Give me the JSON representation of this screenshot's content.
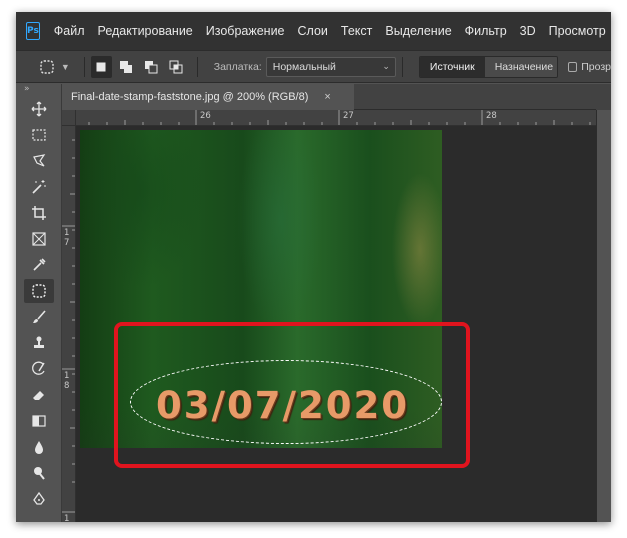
{
  "menubar": {
    "logo": "Ps",
    "items": [
      "Файл",
      "Редактирование",
      "Изображение",
      "Слои",
      "Текст",
      "Выделение",
      "Фильтр",
      "3D",
      "Просмотр"
    ]
  },
  "options": {
    "patch_label": "Заплатка:",
    "patch_mode": "Нормальный",
    "source_label": "Источник",
    "destination_label": "Назначение",
    "transparent_label": "Прозр"
  },
  "document": {
    "tab_title": "Final-date-stamp-faststone.jpg @ 200% (RGB/8)",
    "close_glyph": "×"
  },
  "rulers": {
    "top": [
      "26",
      "27",
      "28"
    ],
    "left": [
      "1",
      "7",
      "1",
      "8",
      "1",
      "9"
    ]
  },
  "image": {
    "date_stamp": "03/07/2020"
  },
  "colors": {
    "accent": "#31a8ff",
    "highlight": "#e0141e",
    "stamp": "#e79a68"
  },
  "icons": {
    "tools": [
      "move-icon",
      "marquee-icon",
      "lasso-icon",
      "magic-wand-icon",
      "crop-icon",
      "frame-icon",
      "eyedropper-icon",
      "patch-icon",
      "brush-icon",
      "stamp-icon",
      "history-brush-icon",
      "eraser-icon",
      "gradient-icon",
      "blur-icon",
      "dodge-icon",
      "pen-icon"
    ]
  }
}
